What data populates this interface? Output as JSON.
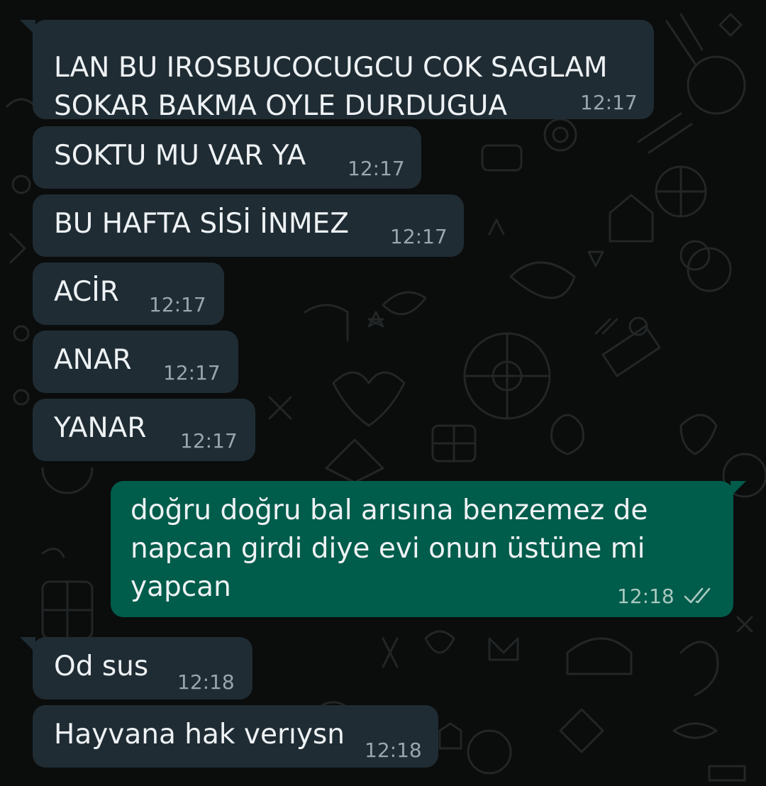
{
  "messages": [
    {
      "id": "m1",
      "direction": "incoming",
      "lines": [
        "LAN BU IROSBUCOCUGCU COK SAGLAM",
        "SOKAR BAKMA OYLE DURDUGUA"
      ],
      "time": "12:17"
    },
    {
      "id": "m2",
      "direction": "incoming",
      "lines": [
        "SOKTU MU VAR YA"
      ],
      "time": "12:17"
    },
    {
      "id": "m3",
      "direction": "incoming",
      "lines": [
        "BU HAFTA SİSİ İNMEZ"
      ],
      "time": "12:17"
    },
    {
      "id": "m4",
      "direction": "incoming",
      "lines": [
        "ACİR"
      ],
      "time": "12:17"
    },
    {
      "id": "m5",
      "direction": "incoming",
      "lines": [
        "ANAR"
      ],
      "time": "12:17"
    },
    {
      "id": "m6",
      "direction": "incoming",
      "lines": [
        "YANAR"
      ],
      "time": "12:17"
    },
    {
      "id": "m7",
      "direction": "outgoing",
      "lines": [
        "doğru doğru bal arısına benzemez de",
        "napcan girdi diye evi onun üstüne mi",
        "yapcan"
      ],
      "time": "12:18",
      "status_icon": "double-check-icon"
    },
    {
      "id": "m8",
      "direction": "incoming",
      "lines": [
        "Od sus"
      ],
      "time": "12:18"
    },
    {
      "id": "m9",
      "direction": "incoming",
      "lines": [
        "Hayvana hak verıysn"
      ],
      "time": "12:18"
    }
  ],
  "colors": {
    "background": "#0b0c0c",
    "incoming_bubble": "#1f2c34",
    "outgoing_bubble": "#005c4b",
    "text": "#e9edef",
    "timestamp": "#9aa6ad"
  }
}
